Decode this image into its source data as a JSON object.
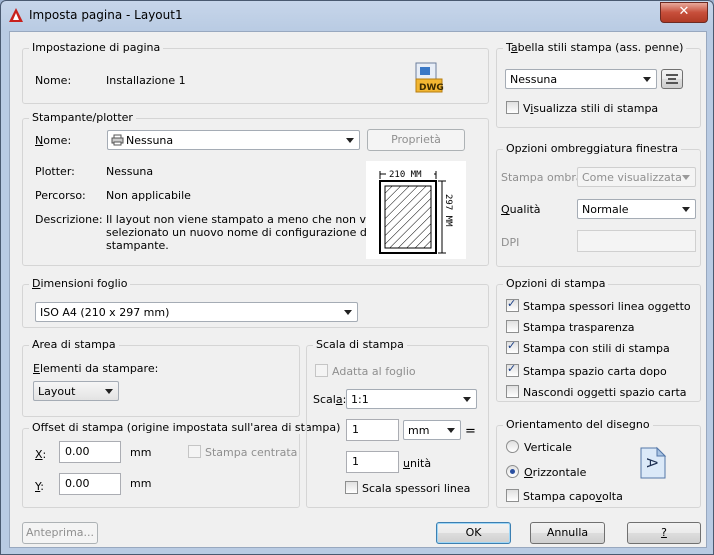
{
  "window": {
    "title": "Imposta pagina - Layout1",
    "close_symbol": "✕"
  },
  "page_setup": {
    "title": "Impostazione di pagina",
    "name_label": "Nome:",
    "name_value": "Installazione 1",
    "dwg_icon_text": "DWG"
  },
  "plotter": {
    "title": "Stampante/plotter",
    "name_label": "Nome:",
    "name_value": "Nessuna",
    "properties_button": "Proprietà",
    "plotter_label": "Plotter:",
    "plotter_value": "Nessuna",
    "path_label": "Percorso:",
    "path_value": "Non applicabile",
    "desc_label": "Descrizione:",
    "desc_lines": [
      "Il layout non viene stampato a meno che non venga",
      "selezionato un nuovo nome di configurazione della",
      "stampante."
    ],
    "preview_width": "210 MM",
    "preview_height": "297 MM"
  },
  "paper_size": {
    "title": "Dimensioni foglio",
    "value": "ISO A4 (210 x 297 mm)"
  },
  "plot_area": {
    "title": "Area di stampa",
    "what_label": "Elementi da stampare:",
    "what_value": "Layout"
  },
  "plot_offset": {
    "title": "Offset di stampa (origine impostata sull'area di stampa)",
    "x_label": "X:",
    "x_value": "0.00",
    "x_unit": "mm",
    "y_label": "Y:",
    "y_value": "0.00",
    "y_unit": "mm",
    "center_label": "Stampa centrata"
  },
  "plot_scale": {
    "title": "Scala di stampa",
    "fit_label": "Adatta al foglio",
    "scale_label": "Scala:",
    "scale_value": "1:1",
    "value1": "1",
    "unit1": "mm",
    "equals": "=",
    "value2": "1",
    "unit2": "unità",
    "lineweights_label": "Scala spessori linea"
  },
  "style_table": {
    "title": "Tabella stili stampa (ass. penne)",
    "value": "Nessuna",
    "display_label": "Visualizza stili di stampa"
  },
  "shaded": {
    "title": "Opzioni ombreggiatura finestra",
    "shade_label": "Stampa ombra",
    "shade_value": "Come visualizzata",
    "quality_label": "Qualità",
    "quality_value": "Normale",
    "dpi_label": "DPI"
  },
  "plot_options": {
    "title": "Opzioni di stampa",
    "items": [
      {
        "label": "Stampa spessori linea oggetto",
        "checked": true
      },
      {
        "label": "Stampa trasparenza",
        "checked": false
      },
      {
        "label": "Stampa con stili di stampa",
        "checked": true
      },
      {
        "label": "Stampa spazio carta dopo",
        "checked": true
      },
      {
        "label": "Nascondi oggetti spazio carta",
        "checked": false
      }
    ]
  },
  "orientation": {
    "title": "Orientamento del disegno",
    "portrait": "Verticale",
    "landscape": "Orizzontale",
    "upside_down": "Stampa capovolta",
    "icon_letter": "A"
  },
  "footer": {
    "preview": "Anteprima...",
    "ok": "OK",
    "cancel": "Annulla",
    "help": "?"
  }
}
